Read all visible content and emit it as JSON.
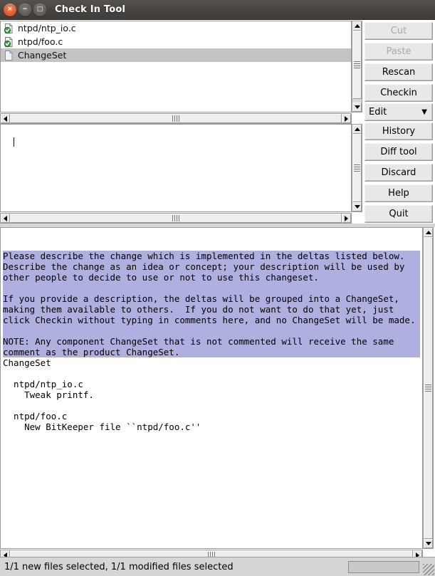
{
  "window": {
    "title": "Check In Tool",
    "controls": [
      {
        "name": "close",
        "glyph": "×"
      },
      {
        "name": "minimize",
        "glyph": "−"
      },
      {
        "name": "maximize",
        "glyph": "□"
      }
    ]
  },
  "file_list": {
    "items": [
      {
        "label": "ntpd/ntp_io.c",
        "icon": "file-modified-icon",
        "selected": false
      },
      {
        "label": "ntpd/foo.c",
        "icon": "file-modified-icon",
        "selected": false
      },
      {
        "label": "ChangeSet",
        "icon": "file-plain-icon",
        "selected": true
      }
    ]
  },
  "buttons": [
    {
      "label": "Cut",
      "name": "cut-button",
      "disabled": true
    },
    {
      "label": "Paste",
      "name": "paste-button",
      "disabled": true
    },
    {
      "label": "Rescan",
      "name": "rescan-button",
      "disabled": false
    },
    {
      "label": "Checkin",
      "name": "checkin-button",
      "disabled": false
    }
  ],
  "edit_menu": {
    "label": "Edit",
    "arrow": "▼"
  },
  "buttons_lower": [
    {
      "label": "History",
      "name": "history-button",
      "disabled": false
    },
    {
      "label": "Diff tool",
      "name": "diff-tool-button",
      "disabled": false
    },
    {
      "label": "Discard",
      "name": "discard-button",
      "disabled": false
    },
    {
      "label": "Help",
      "name": "help-button",
      "disabled": false
    },
    {
      "label": "Quit",
      "name": "quit-button",
      "disabled": false
    }
  ],
  "diff_pane": {
    "value": ""
  },
  "comments_pane": {
    "instructions": "Please describe the change which is implemented in the deltas listed below.\nDescribe the change as an idea or concept; your description will be used by\nother people to decide to use or not to use this changeset.\n\nIf you provide a description, the deltas will be grouped into a ChangeSet,\nmaking them available to others.  If you do not want to do that yet, just\nclick Checkin without typing in comments here, and no ChangeSet will be made.\n\nNOTE: Any component ChangeSet that is not commented will receive the same\ncomment as the product ChangeSet.",
    "body": "ChangeSet\n\n  ntpd/ntp_io.c\n    Tweak printf.\n\n  ntpd/foo.c\n    New BitKeeper file ``ntpd/foo.c''"
  },
  "status": {
    "text": "1/1 new files selected, 1/1 modified files selected"
  },
  "colors": {
    "highlight": "#b0b0e0",
    "selection": "#c3c3c3",
    "titlebar": "#474340",
    "close_button": "#d8542a",
    "widget_face": "#e8e8e8"
  }
}
